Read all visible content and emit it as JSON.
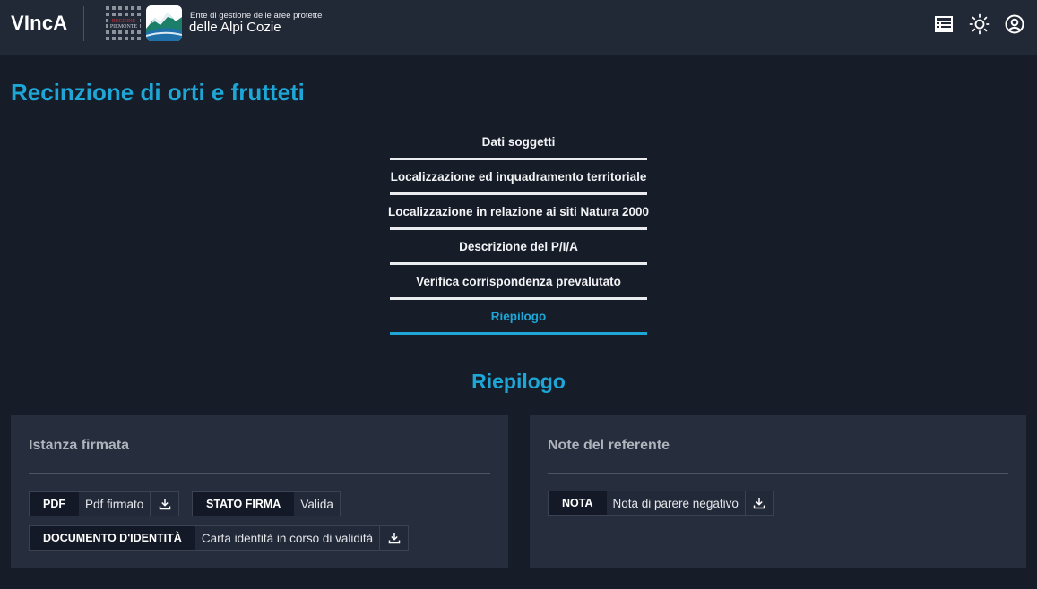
{
  "header": {
    "app_title": "VIncA",
    "regione_logo_text": [
      "REGIONE",
      "PIEMONTE"
    ],
    "ente_line1": "Ente di gestione delle aree protette",
    "ente_line2": "delle Alpi Cozie",
    "icons": [
      "table-icon",
      "sun-icon",
      "user-account-icon"
    ]
  },
  "page": {
    "title": "Recinzione di orti e frutteti"
  },
  "stepper": {
    "steps": [
      {
        "label": "Dati soggetti",
        "active": false
      },
      {
        "label": "Localizzazione ed inquadramento territoriale",
        "active": false
      },
      {
        "label": "Localizzazione in relazione ai siti Natura 2000",
        "active": false
      },
      {
        "label": "Descrizione del P/I/A",
        "active": false
      },
      {
        "label": "Verifica corrispondenza prevalutato",
        "active": false
      },
      {
        "label": "Riepilogo",
        "active": true
      }
    ]
  },
  "summary": {
    "title": "Riepilogo",
    "istanza": {
      "title": "Istanza firmata",
      "pdf_key": "PDF",
      "pdf_value": "Pdf firmato",
      "stato_key": "STATO FIRMA",
      "stato_value": "Valida",
      "doc_key": "DOCUMENTO D'IDENTITÀ",
      "doc_value": "Carta identità in corso di validità"
    },
    "note": {
      "title": "Note del referente",
      "nota_key": "NOTA",
      "nota_value": "Nota di parere negativo"
    }
  },
  "colors": {
    "accent": "#1da6d6",
    "background": "#161c28",
    "header": "#212836",
    "card": "#262d3c"
  }
}
